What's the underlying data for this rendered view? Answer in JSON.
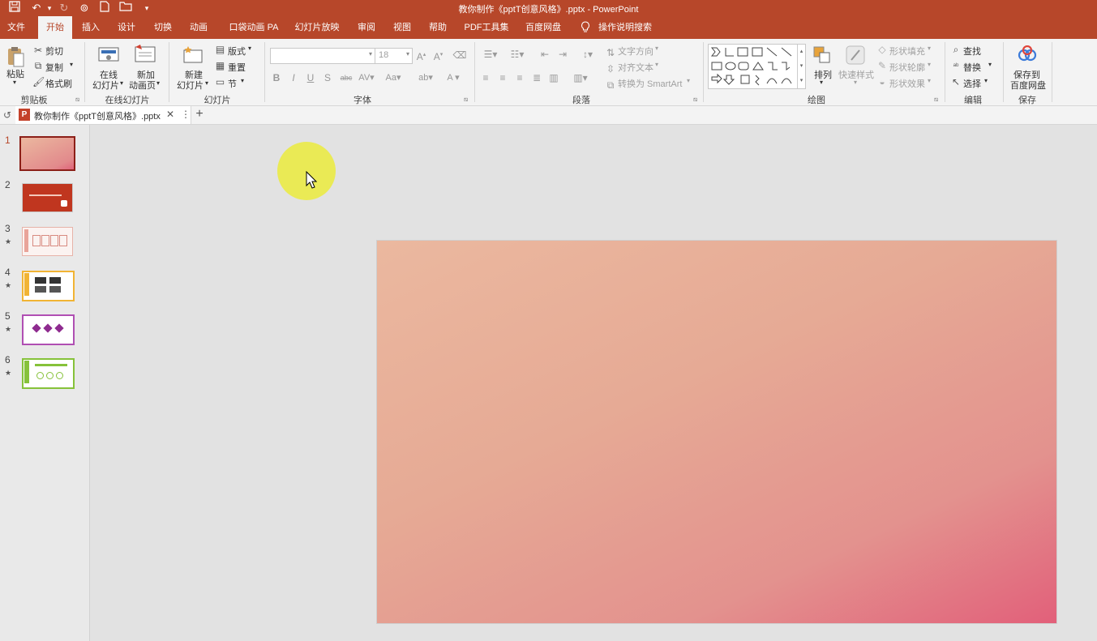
{
  "window": {
    "title": "教你制作《pptT创意风格》.pptx  -  PowerPoint"
  },
  "tabs": [
    "文件",
    "开始",
    "插入",
    "设计",
    "切换",
    "动画",
    "口袋动画 PA",
    "幻灯片放映",
    "审阅",
    "视图",
    "帮助",
    "PDF工具集",
    "百度网盘",
    "操作说明搜索"
  ],
  "ribbon": {
    "clipboard": {
      "paste": "粘贴",
      "cut": "剪切",
      "copy": "复制",
      "format_painter": "格式刷",
      "label": "剪贴板"
    },
    "online_slides": {
      "online": [
        "在线",
        "幻灯片"
      ],
      "new_anim": [
        "新加",
        "动画页"
      ],
      "label": "在线幻灯片"
    },
    "slides": {
      "new_slide": [
        "新建",
        "幻灯片"
      ],
      "layout": "版式",
      "reset": "重置",
      "section": "节",
      "label": "幻灯片"
    },
    "font": {
      "font_size": "18",
      "label": "字体"
    },
    "paragraph": {
      "text_direction": "文字方向",
      "align_text": "对齐文本",
      "smartart": "转换为 SmartArt",
      "label": "段落"
    },
    "drawing": {
      "arrange": "排列",
      "quick_styles": "快速样式",
      "shape_fill": "形状填充",
      "shape_outline": "形状轮廓",
      "shape_effects": "形状效果",
      "label": "绘图"
    },
    "editing": {
      "find": "查找",
      "replace": "替换",
      "select": "选择",
      "label": "编辑"
    },
    "save": {
      "save_to": [
        "保存到",
        "百度网盘"
      ],
      "label": "保存"
    }
  },
  "doc_tab": {
    "name": "教你制作《pptT创意风格》.pptx"
  },
  "slides": [
    {
      "num": "1",
      "star": ""
    },
    {
      "num": "2",
      "star": ""
    },
    {
      "num": "3",
      "star": "★"
    },
    {
      "num": "4",
      "star": "★"
    },
    {
      "num": "5",
      "star": "★"
    },
    {
      "num": "6",
      "star": "★"
    }
  ],
  "colors": {
    "accent": "#b7472a",
    "ribbon_bg": "#f3f3f3"
  }
}
